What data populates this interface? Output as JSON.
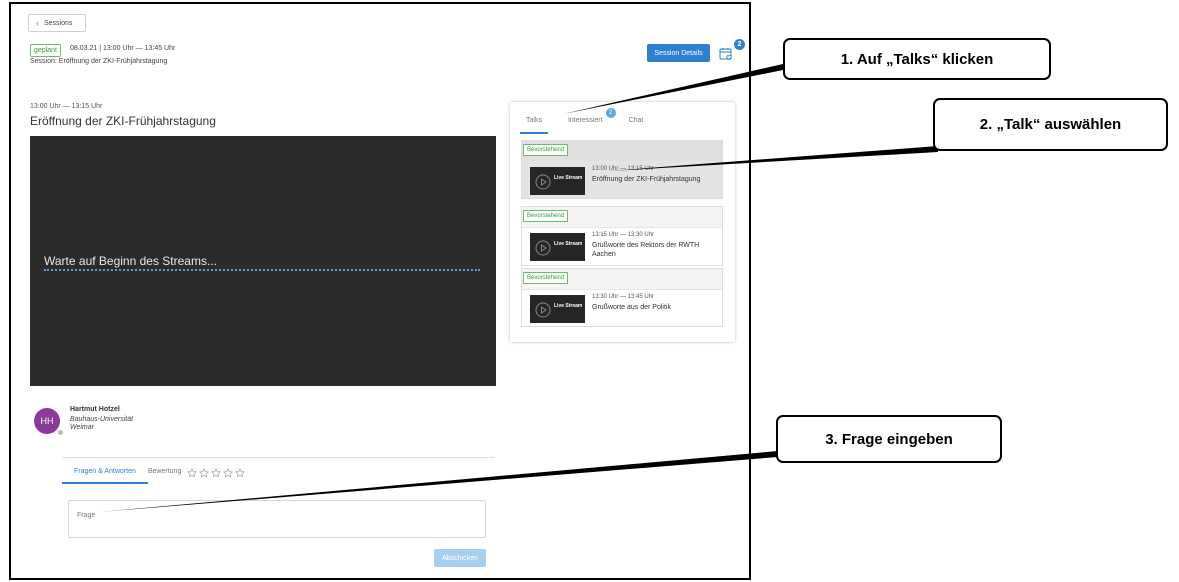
{
  "header": {
    "back_label": "Sessions",
    "status": "geplant",
    "datetime": "08.03.21 | 13:00 Uhr — 13:45 Uhr",
    "session": "Session: Eröffnung der ZKI-Frühjahrstagung",
    "details_button": "Session Details",
    "calendar_badge": "2"
  },
  "talk": {
    "time": "13:00 Uhr — 13:15 Uhr",
    "title": "Eröffnung der ZKI-Frühjahrstagung",
    "player_message": "Warte auf Beginn des Streams..."
  },
  "speaker": {
    "initials": "HH",
    "name": "Hartmut Hotzel",
    "affiliation": "Bauhaus-Universität Weimar"
  },
  "qa": {
    "tab_questions": "Fragen & Antworten",
    "tab_rating": "Bewertung",
    "rating_max": 5,
    "question_placeholder": "Frage",
    "submit_label": "Abschicken"
  },
  "panel": {
    "tabs": [
      {
        "label": "Talks",
        "active": true
      },
      {
        "label": "Interessiert",
        "badge": "2"
      },
      {
        "label": "Chat"
      }
    ],
    "cards": [
      {
        "status": "Bevorstehend",
        "thumb_label": "Live Stream",
        "time": "13:00 Uhr — 13:15 Uhr",
        "title": "Eröffnung der ZKI-Frühjahrstagung",
        "selected": true
      },
      {
        "status": "Bevorstehend",
        "thumb_label": "Live Stream",
        "time": "13:15 Uhr — 13:30 Uhr",
        "title": "Grußworte des Rektors der RWTH Aachen"
      },
      {
        "status": "Bevorstehend",
        "thumb_label": "Live Stream",
        "time": "13:30 Uhr — 13:45 Uhr",
        "title": "Grußworte aus der Politik"
      }
    ]
  },
  "callouts": [
    "1. Auf „Talks“ klicken",
    "2. „Talk“ auswählen",
    "3. Frage eingeben"
  ]
}
